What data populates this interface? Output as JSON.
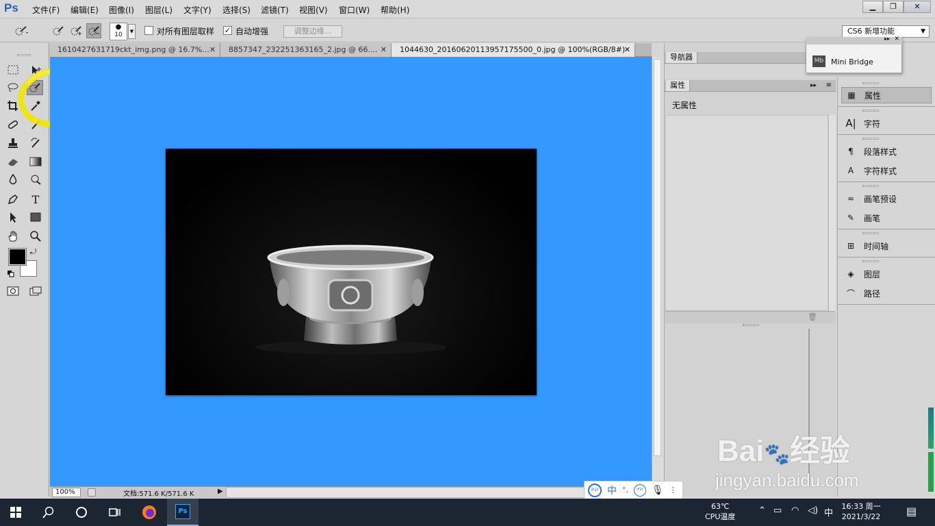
{
  "app": {
    "logo": "Ps"
  },
  "menu": [
    "文件(F)",
    "编辑(E)",
    "图像(I)",
    "图层(L)",
    "文字(Y)",
    "选择(S)",
    "滤镜(T)",
    "视图(V)",
    "窗口(W)",
    "帮助(H)"
  ],
  "window_controls": {
    "minimize": "▁",
    "restore": "❐",
    "close": "✕"
  },
  "options": {
    "brush_size": "10",
    "sample_all_label": "对所有图层取样",
    "sample_all_checked": false,
    "auto_enhance_label": "自动增强",
    "auto_enhance_checked": true,
    "refine_edge_label": "调整边缘...",
    "workspace": "CS6 新增功能"
  },
  "tabs": [
    {
      "label": "1610427631719ckt_img.png @ 16.7%...",
      "close": "✕"
    },
    {
      "label": "8857347_232251363165_2.jpg @ 66....",
      "close": "✕"
    },
    {
      "label": "1044630_20160620113957175500_0.jpg @ 100%(RGB/8#)",
      "close": "✕"
    }
  ],
  "status": {
    "zoom": "100%",
    "doc": "文档:571.6 K/571.6 K"
  },
  "panels": {
    "navigator_title": "导航器",
    "properties_title": "属性",
    "no_properties": "无属性"
  },
  "mini_bridge": {
    "icon": "Mb",
    "label": "Mini Bridge"
  },
  "right_panel": [
    {
      "label": "属性",
      "icon": "properties-icon"
    },
    {
      "label": "字符",
      "icon": "character-icon"
    },
    {
      "label": "段落样式",
      "icon": "paragraph-styles-icon"
    },
    {
      "label": "字符样式",
      "icon": "character-styles-icon"
    },
    {
      "label": "画笔预设",
      "icon": "brush-presets-icon"
    },
    {
      "label": "画笔",
      "icon": "brush-icon"
    },
    {
      "label": "时间轴",
      "icon": "timeline-icon"
    },
    {
      "label": "图层",
      "icon": "layers-icon"
    },
    {
      "label": "路径",
      "icon": "paths-icon"
    }
  ],
  "ime": {
    "mode": "中",
    "punct": "°,"
  },
  "system": {
    "temp": "63℃",
    "temp_label": "CPU温度",
    "time": "16:33 周一",
    "date": "2021/3/22"
  },
  "watermark": {
    "brand": "Bai",
    "brand2": "经验",
    "url": "jingyan.baidu.com"
  },
  "colors": {
    "canvas_bg": "#3399ff",
    "highlight": "#f2e600",
    "taskbar": "#1c2632"
  }
}
